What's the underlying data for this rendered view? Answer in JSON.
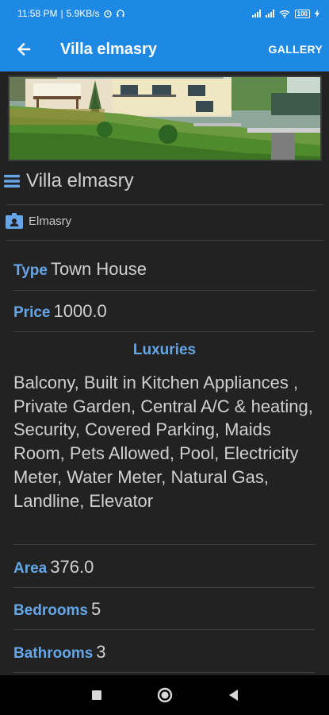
{
  "status_bar": {
    "time": "11:58 PM",
    "speed": "5.9KB/s",
    "battery": "100"
  },
  "app_bar": {
    "title": "Villa elmasry",
    "gallery_label": "GALLERY"
  },
  "property": {
    "name": "Villa elmasry",
    "owner": "Elmasry"
  },
  "details": {
    "type_label": "Type",
    "type_value": "Town House",
    "price_label": "Price",
    "price_value": "1000.0",
    "luxuries_title": "Luxuries",
    "luxuries_text": "Balcony, Built in Kitchen Appliances , Private Garden, Central A/C & heating, Security, Covered Parking, Maids Room, Pets Allowed, Pool, Electricity Meter, Water Meter, Natural Gas, Landline, Elevator",
    "area_label": "Area",
    "area_value": "376.0",
    "bedrooms_label": "Bedrooms",
    "bedrooms_value": "5",
    "bathrooms_label": "Bathrooms",
    "bathrooms_value": "3"
  },
  "colors": {
    "app_bar": "#1e88e5",
    "accent_label": "#64a6e8",
    "background": "#222222"
  }
}
